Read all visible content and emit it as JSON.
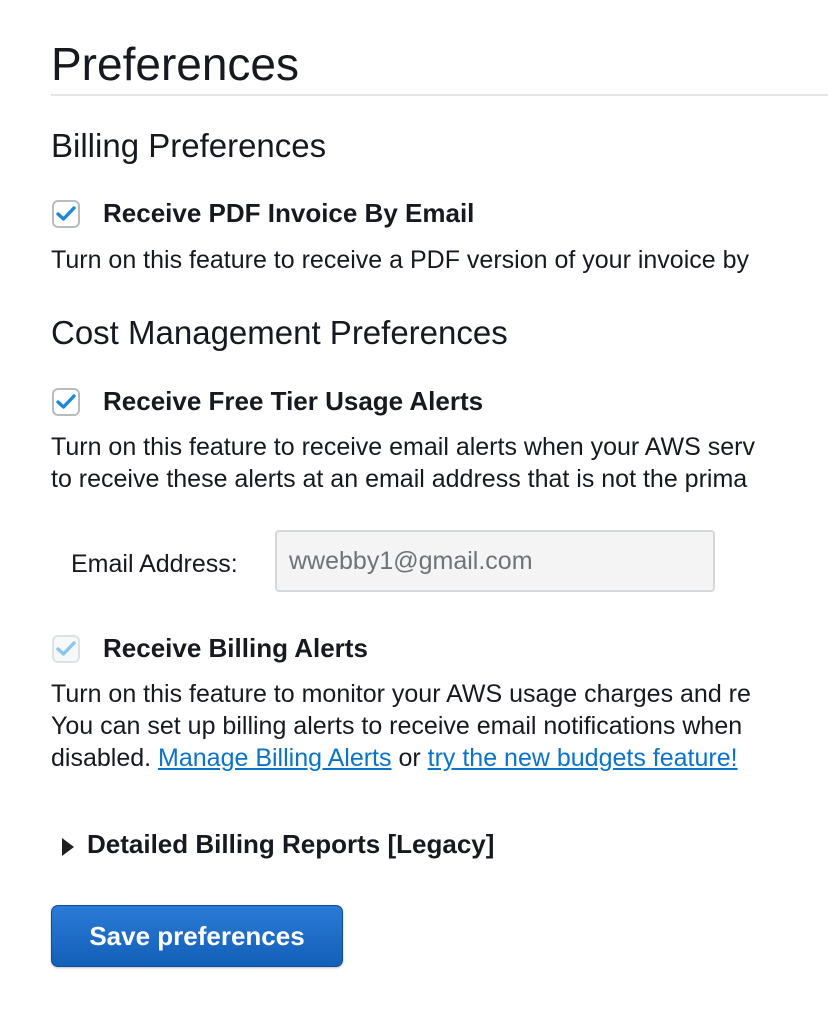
{
  "page": {
    "title": "Preferences"
  },
  "billing": {
    "heading": "Billing Preferences",
    "pdf_invoice": {
      "label": "Receive PDF Invoice By Email",
      "checked": true,
      "description": "Turn on this feature to receive a PDF version of your invoice by"
    }
  },
  "cost_management": {
    "heading": "Cost Management Preferences",
    "free_tier": {
      "label": "Receive Free Tier Usage Alerts",
      "checked": true,
      "description_lines": [
        "Turn on this feature to receive email alerts when your AWS serv",
        "to receive these alerts at an email address that is not the prima"
      ],
      "email_label": "Email Address:",
      "email_value": "wwebby1@gmail.com"
    },
    "billing_alerts": {
      "label": "Receive Billing Alerts",
      "checked": true,
      "disabled": true,
      "description_lines": [
        "Turn on this feature to monitor your AWS usage charges and re",
        "You can set up billing alerts to receive email notifications when",
        "disabled."
      ],
      "manage_link": "Manage Billing Alerts",
      "connector": "or",
      "budgets_link": "try the new budgets feature!"
    }
  },
  "detailed_reports": {
    "label": "Detailed Billing Reports [Legacy]"
  },
  "actions": {
    "save_label": "Save preferences"
  },
  "colors": {
    "check_blue": "#1d87d9",
    "check_disabled": "#8cc6ee",
    "link": "#0a73c9",
    "primary_button": "#1a69c4"
  },
  "icons": {
    "checkbox_check": "check-icon",
    "disclosure": "triangle-right-icon"
  }
}
